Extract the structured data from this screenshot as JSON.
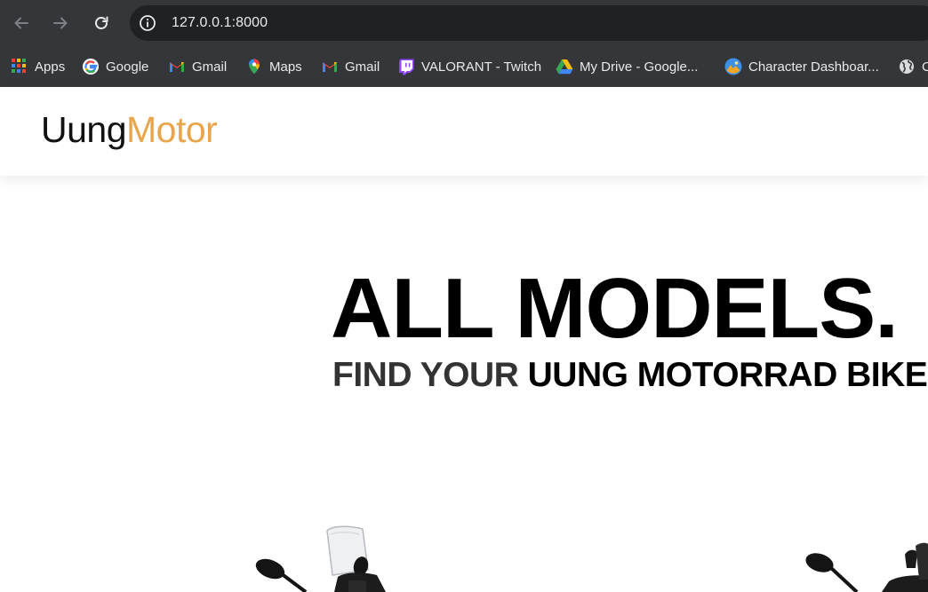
{
  "browser": {
    "url": "127.0.0.1:8000",
    "bookmarks": [
      {
        "label": "Apps",
        "icon": "apps-grid-icon"
      },
      {
        "label": "Google",
        "icon": "google-icon"
      },
      {
        "label": "Gmail",
        "icon": "gmail-icon"
      },
      {
        "label": "Maps",
        "icon": "maps-icon"
      },
      {
        "label": "Gmail",
        "icon": "gmail-icon"
      },
      {
        "label": "VALORANT - Twitch",
        "icon": "twitch-icon"
      },
      {
        "label": "My Drive - Google...",
        "icon": "drive-icon"
      },
      {
        "label": "Character Dashboar...",
        "icon": "character-icon"
      },
      {
        "label": "C",
        "icon": "globe-icon"
      }
    ]
  },
  "site": {
    "logo_part1": "Uung",
    "logo_part2": "Motor",
    "hero_title": "ALL MODELS.",
    "hero_sub_part1": "FIND YOUR ",
    "hero_sub_part2": "UUNG MOTORRAD BIKE"
  },
  "colors": {
    "brand_accent": "#e8a54b",
    "browser_bar": "#35363a",
    "omnibox": "#202124"
  }
}
